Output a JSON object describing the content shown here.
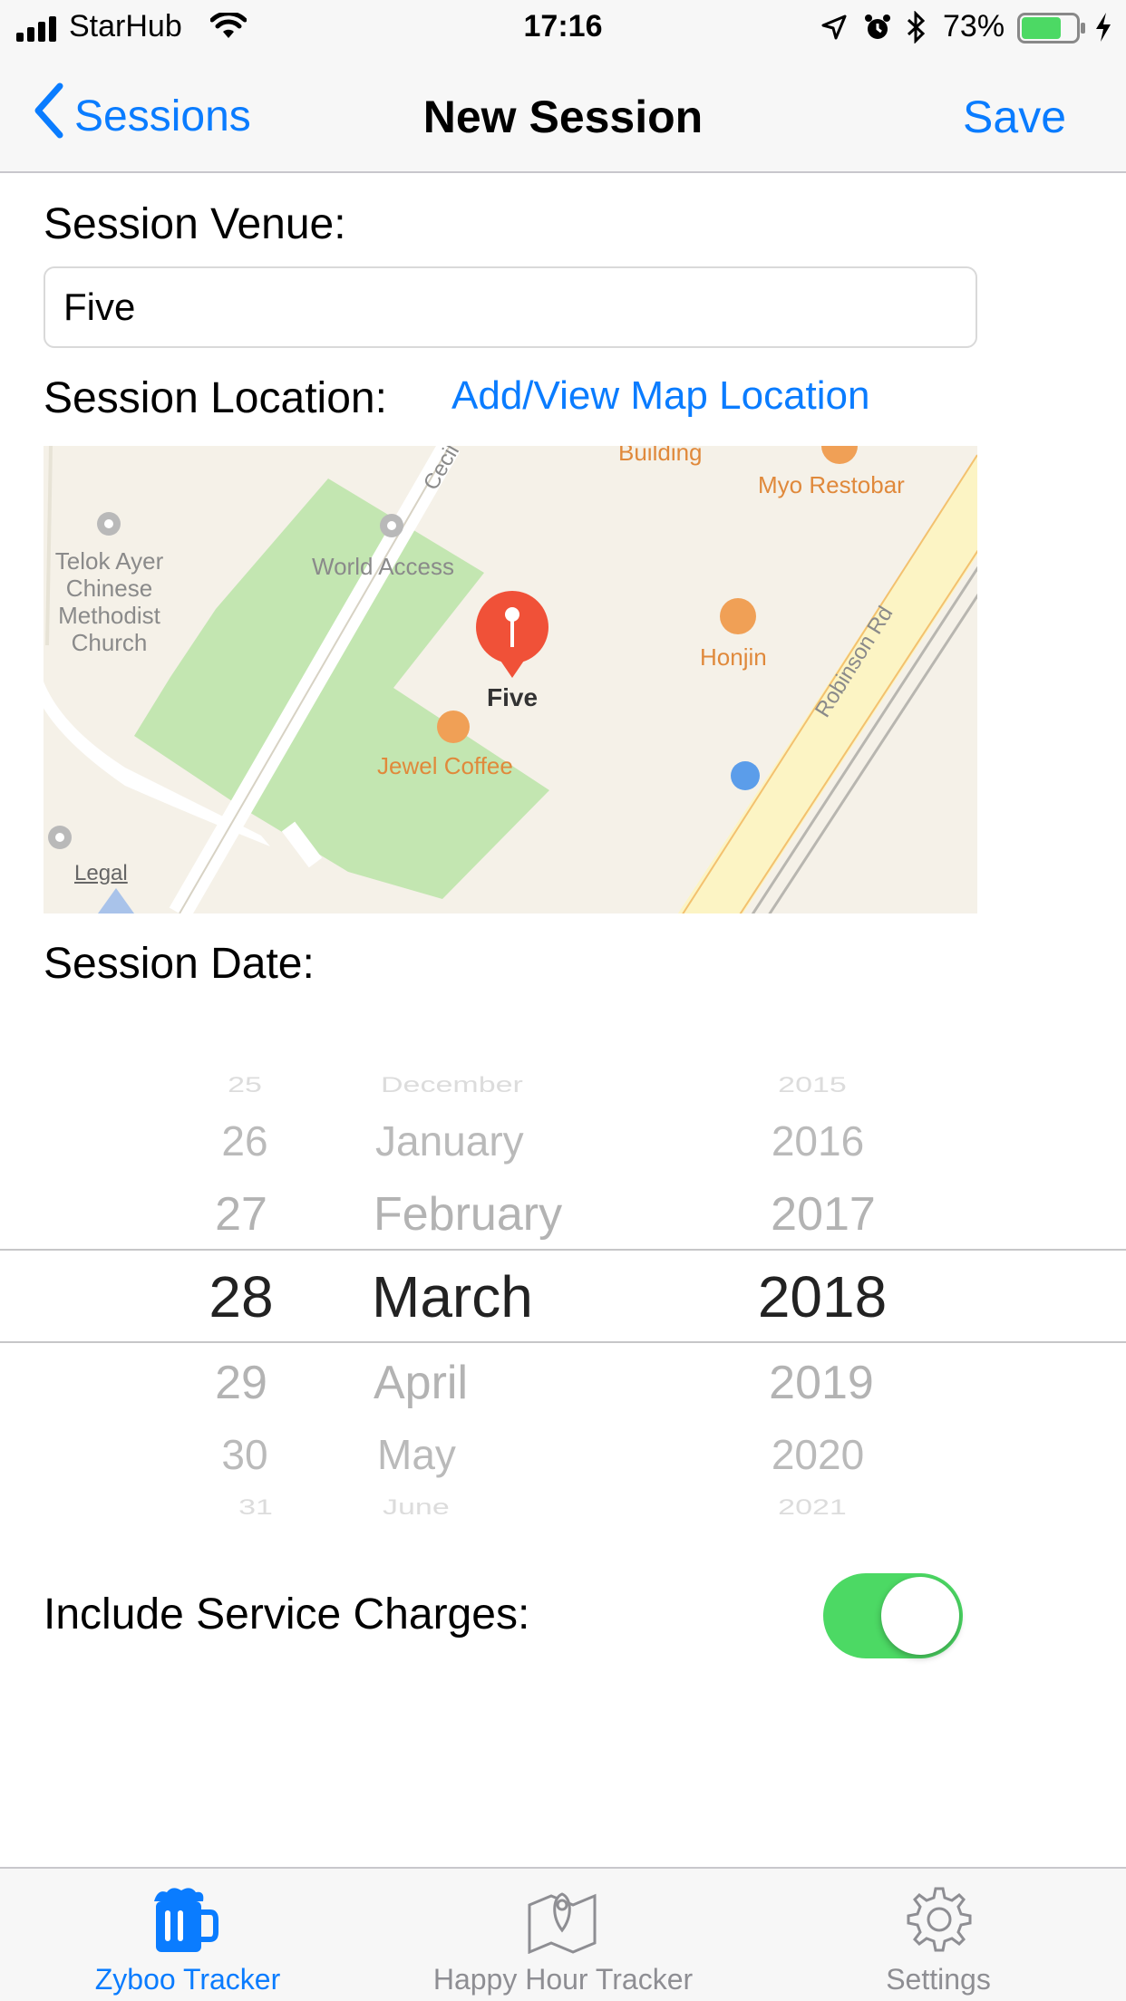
{
  "status_bar": {
    "carrier": "StarHub",
    "time": "17:16",
    "battery_percent": "73%",
    "battery_level": 0.73
  },
  "nav": {
    "back_label": "Sessions",
    "title": "New Session",
    "save_label": "Save"
  },
  "form": {
    "venue_label": "Session Venue:",
    "venue_value": "Five",
    "location_label": "Session Location:",
    "map_link": "Add/View Map Location",
    "date_label": "Session Date:",
    "service_label": "Include Service Charges:",
    "service_on": true
  },
  "map": {
    "pin_label": "Five",
    "places": [
      "Telok Ayer",
      "Chinese",
      "Methodist",
      "Church",
      "World Access",
      "Jewel Coffee",
      "Honjin",
      "Myo Restobar",
      "Building",
      "Cecil St",
      "Robinson Rd"
    ],
    "legal": "Legal"
  },
  "date_picker": {
    "days": [
      "25",
      "26",
      "27",
      "28",
      "29",
      "30",
      "31"
    ],
    "months": [
      "December",
      "January",
      "February",
      "March",
      "April",
      "May",
      "June"
    ],
    "years": [
      "2015",
      "2016",
      "2017",
      "2018",
      "2019",
      "2020",
      "2021"
    ],
    "selected": {
      "day": "28",
      "month": "March",
      "year": "2018"
    }
  },
  "tabs": [
    {
      "label": "Zyboo Tracker",
      "active": true,
      "icon": "beer-mug-icon"
    },
    {
      "label": "Happy Hour Tracker",
      "active": false,
      "icon": "map-pin-icon"
    },
    {
      "label": "Settings",
      "active": false,
      "icon": "gear-icon"
    }
  ],
  "colors": {
    "accent": "#0a7cff",
    "toggle_on": "#4cd964",
    "pin": "#f05138"
  }
}
